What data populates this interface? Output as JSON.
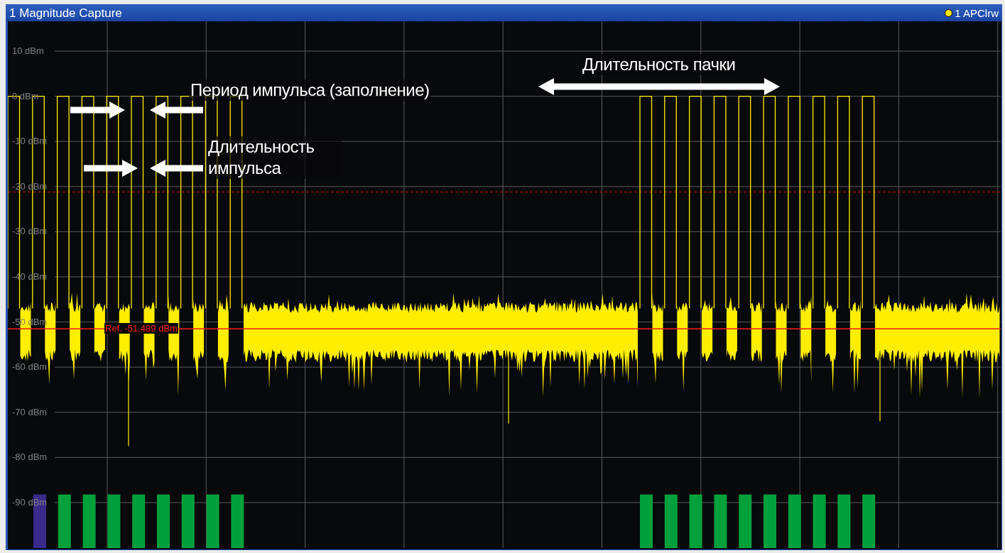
{
  "window": {
    "title": "1 Magnitude Capture"
  },
  "trace_indicator": {
    "label": "1 APClrw",
    "color": "#ffe800"
  },
  "y_axis": {
    "ticks": [
      "10 dBm",
      "0 dBm",
      "-10 dBm",
      "-20 dBm",
      "-30 dBm",
      "-40 dBm",
      "-50 dBm",
      "-60 dBm",
      "-70 dBm",
      "-80 dBm",
      "-90 dBm"
    ]
  },
  "reference_line": {
    "label": "Ref. -51.489 dBm"
  },
  "annotations": [
    {
      "kind": "period",
      "text": "Период импульса (заполнение)"
    },
    {
      "kind": "width",
      "text": "Длительность импульса"
    },
    {
      "kind": "burst",
      "text": "Длительность пачки"
    }
  ],
  "pulse_markers_left": [
    {
      "color": "#3a2a8a"
    },
    {
      "color": "#00a03c"
    },
    {
      "color": "#00a03c"
    },
    {
      "color": "#00a03c"
    },
    {
      "color": "#00a03c"
    },
    {
      "color": "#00a03c"
    },
    {
      "color": "#00a03c"
    },
    {
      "color": "#00a03c"
    },
    {
      "color": "#00a03c"
    }
  ],
  "pulse_markers_right": [
    {
      "color": "#00a03c"
    },
    {
      "color": "#00a03c"
    },
    {
      "color": "#00a03c"
    },
    {
      "color": "#00a03c"
    },
    {
      "color": "#00a03c"
    },
    {
      "color": "#00a03c"
    },
    {
      "color": "#00a03c"
    },
    {
      "color": "#00a03c"
    },
    {
      "color": "#00a03c"
    },
    {
      "color": "#00a03c"
    }
  ]
}
